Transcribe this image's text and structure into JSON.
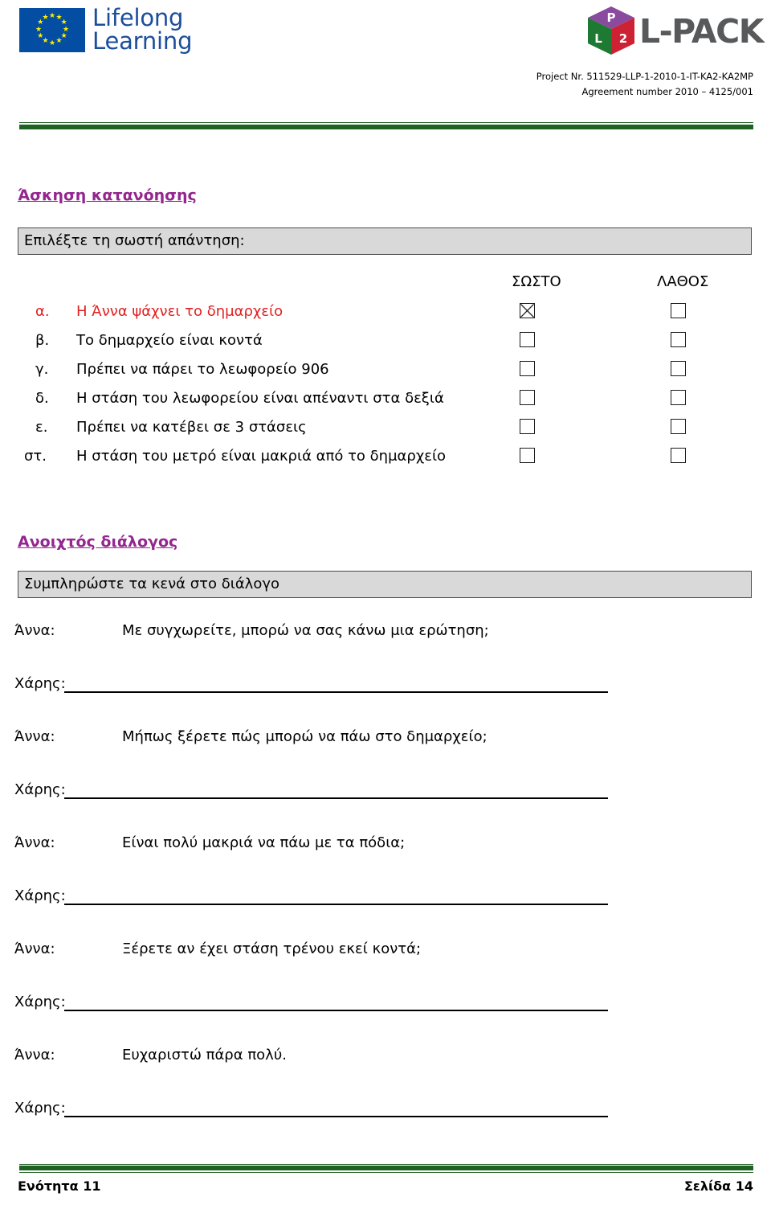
{
  "header": {
    "eu_logo": {
      "line1": "Lifelong",
      "line2": "Learning",
      "icon": "eu-flag-icon"
    },
    "lpack_logo": {
      "wordmark": "L-PACK",
      "cube_top": "P",
      "cube_left": "L",
      "cube_right": "2"
    },
    "project_number": "Project Nr. 511529-LLP-1-2010-1-IT-KA2-KA2MP",
    "agreement_number": "Agreement number 2010 – 4125/001"
  },
  "comprehension": {
    "heading": "Άσκηση κατανόησης",
    "instruction": "Επιλέξτε τη σωστή απάντηση:",
    "col_true": "ΣΩΣΤΟ",
    "col_false": "ΛΑΘΟΣ",
    "rows": [
      {
        "letter": "α.",
        "text": "Η Άννα ψάχνει το δημαρχείο",
        "true_checked": true,
        "false_checked": false,
        "color": "#e02020"
      },
      {
        "letter": "β.",
        "text": "Το δημαρχείο είναι κοντά",
        "true_checked": false,
        "false_checked": false,
        "color": "#000000"
      },
      {
        "letter": "γ.",
        "text": "Πρέπει να πάρει το λεωφορείο 906",
        "true_checked": false,
        "false_checked": false,
        "color": "#000000"
      },
      {
        "letter": "δ.",
        "text": "Η στάση του λεωφορείου είναι απέναντι στα δεξιά",
        "true_checked": false,
        "false_checked": false,
        "color": "#000000"
      },
      {
        "letter": "ε.",
        "text": "Πρέπει να κατέβει σε 3 στάσεις",
        "true_checked": false,
        "false_checked": false,
        "color": "#000000"
      },
      {
        "letter": "στ.",
        "text": "Η στάση του μετρό είναι μακριά από το δημαρχείο",
        "true_checked": false,
        "false_checked": false,
        "color": "#000000"
      }
    ]
  },
  "open_dialogue": {
    "heading": "Ανοιχτός διάλογος",
    "instruction": "Συμπληρώστε τα κενά στο διάλογο",
    "speaker_a": "Άννα:",
    "speaker_b": "Χάρης:",
    "turns": [
      {
        "speaker": "Άννα:",
        "text": "Με συγχωρείτε, μπορώ να σας κάνω μια ερώτηση;",
        "blank": false
      },
      {
        "speaker": "Χάρης:",
        "text": "",
        "blank": true
      },
      {
        "speaker": "Άννα:",
        "text": "Μήπως ξέρετε πώς μπορώ να πάω στο δημαρχείο;",
        "blank": false
      },
      {
        "speaker": "Χάρης:",
        "text": "",
        "blank": true
      },
      {
        "speaker": "Άννα:",
        "text": "Είναι πολύ μακριά να πάω με τα πόδια;",
        "blank": false
      },
      {
        "speaker": "Χάρης:",
        "text": "",
        "blank": true
      },
      {
        "speaker": "Άννα:",
        "text": "Ξέρετε αν έχει στάση τρένου εκεί κοντά;",
        "blank": false
      },
      {
        "speaker": "Χάρης:",
        "text": "",
        "blank": true
      },
      {
        "speaker": "Άννα:",
        "text": "Ευχαριστώ πάρα πολύ.",
        "blank": false
      },
      {
        "speaker": "Χάρης:",
        "text": "",
        "blank": true
      }
    ]
  },
  "footer": {
    "unit": "Ενότητα 11",
    "page": "Σελίδα 14"
  },
  "colors": {
    "heading_purple": "#93278f",
    "rule_green": "#1f6123",
    "eu_blue": "#034ea2",
    "red_row": "#e02020",
    "box_gray": "#d9d9d9"
  }
}
